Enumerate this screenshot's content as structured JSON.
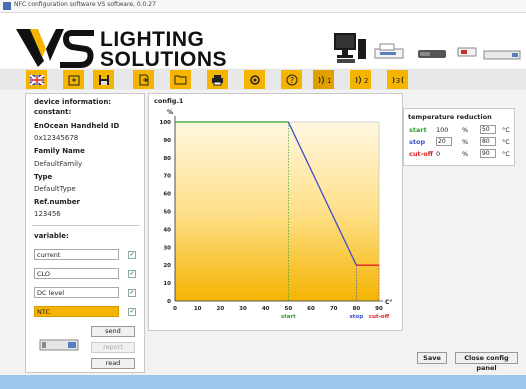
{
  "window": {
    "title": "NFC configuration software VS software, 0.0.27"
  },
  "brand": {
    "line1": "LIGHTING",
    "line2": "SOLUTIONS",
    "color": "#f4b400"
  },
  "toolbar": {
    "icons": [
      "uk-flag-icon",
      "open-folder-icon",
      "save-icon",
      "export-icon",
      "folder-icon",
      "print-icon",
      "settings-icon",
      "help-icon",
      "read-nfc-icon",
      "write-nfc-icon",
      "nfc-transfer-icon"
    ]
  },
  "device": {
    "heading": "device information:",
    "constant": "constant:",
    "id_label": "EnOcean Handheld ID",
    "id_value": "0x12345678",
    "family_label": "Family Name",
    "family_value": "DefaultFamily",
    "type_label": "Type",
    "type_value": "DefaultType",
    "ref_label": "Ref.number",
    "ref_value": "123456"
  },
  "variable": {
    "heading": "variable:",
    "items": [
      {
        "label": "current",
        "checked": true,
        "selected": false
      },
      {
        "label": "CLO",
        "checked": true,
        "selected": false
      },
      {
        "label": "DC level",
        "checked": true,
        "selected": false
      },
      {
        "label": "NTC",
        "checked": true,
        "selected": true
      }
    ],
    "send": "send",
    "report": "report",
    "read": "read"
  },
  "chart_panel": {
    "title": "config.1"
  },
  "chart_data": {
    "type": "line",
    "title": "",
    "ylabel": "%",
    "xlabel": "C°",
    "xlim": [
      0,
      90
    ],
    "ylim": [
      0,
      100
    ],
    "xticks": [
      0,
      10,
      20,
      30,
      40,
      50,
      60,
      70,
      80,
      90
    ],
    "yticks": [
      0,
      10,
      20,
      30,
      40,
      50,
      60,
      70,
      80,
      90,
      100
    ],
    "segments": [
      {
        "name": "start",
        "color": "#2e9e2e",
        "x": [
          0,
          50
        ],
        "y": [
          100,
          100
        ]
      },
      {
        "name": "stop",
        "color": "#3a4fd0",
        "x": [
          50,
          80
        ],
        "y": [
          100,
          20
        ]
      },
      {
        "name": "cut-off",
        "color": "#e02020",
        "x": [
          80,
          90
        ],
        "y": [
          20,
          20
        ]
      }
    ],
    "markers": [
      {
        "label": "start",
        "x": 50,
        "color": "#2e9e2e"
      },
      {
        "label": "stop",
        "x": 80,
        "color": "#3a4fd0"
      },
      {
        "label": "cut-off",
        "x": 90,
        "color": "#e02020"
      }
    ]
  },
  "temperature": {
    "title": "temperature reduction",
    "rows": [
      {
        "name": "start",
        "color": "#2e9e2e",
        "percent": "100",
        "temp": "50",
        "editable_percent": false
      },
      {
        "name": "stop",
        "color": "#3a4fd0",
        "percent": "20",
        "temp": "80",
        "editable_percent": true
      },
      {
        "name": "cut-off",
        "color": "#e02020",
        "percent": "0",
        "temp": "90",
        "editable_percent": false
      }
    ],
    "pct_unit": "%",
    "temp_unit": "°C"
  },
  "footer": {
    "save": "Save",
    "close": "Close config panel"
  }
}
